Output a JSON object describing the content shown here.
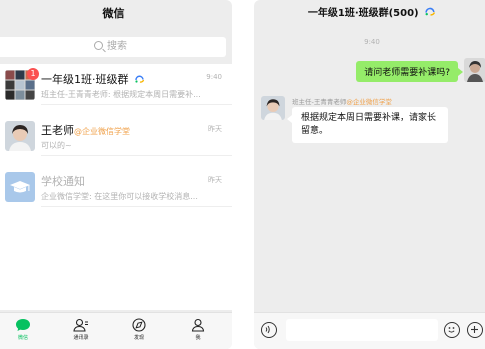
{
  "left": {
    "title": "微信",
    "search_placeholder": "搜索",
    "chats": [
      {
        "name": "一年级1班·班级群",
        "preview": "班主任-王青青老师: 根据规定本周日需要补...",
        "time": "9:40",
        "badge": "1"
      },
      {
        "name": "王老师",
        "ident": "@企业微信学堂",
        "preview": "可以的~",
        "time": "昨天"
      },
      {
        "name": "学校通知",
        "preview": "企业微信学堂: 在这里你可以接收学校消息...",
        "time": "昨天"
      }
    ],
    "tabs": [
      "微信",
      "通讯录",
      "发现",
      "我"
    ]
  },
  "right": {
    "title": "一年级1班·班级群(500)",
    "time": "9:40",
    "out_message": "请问老师需要补课吗?",
    "sender_name": "班主任-王青青老师",
    "sender_ident": "@企业微信学堂",
    "in_message": "根据规定本周日需要补课，请家长留意。"
  },
  "colors": {
    "accent": "#07c160",
    "bubble_out": "#95ec69",
    "ident": "#f0a14a",
    "badge": "#fa5151"
  }
}
